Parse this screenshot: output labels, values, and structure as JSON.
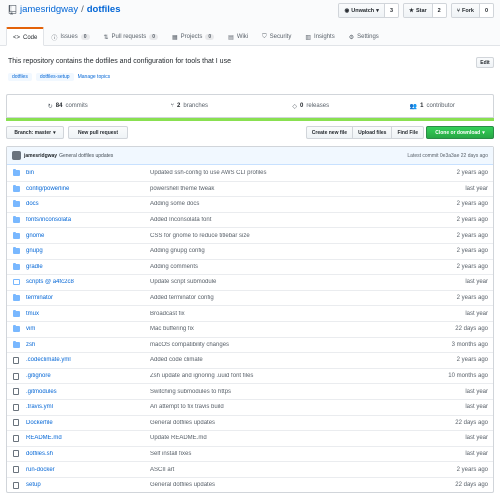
{
  "repo": {
    "owner": "jamesridgway",
    "separator": "/",
    "name": "dotfiles"
  },
  "actions": [
    {
      "label": "Unwatch",
      "count": "3",
      "icon": "eye-icon"
    },
    {
      "label": "Star",
      "count": "2",
      "icon": "star-icon"
    },
    {
      "label": "Fork",
      "count": "0",
      "icon": "fork-icon"
    }
  ],
  "tabs": [
    {
      "label": "Code",
      "icon": "code-icon",
      "active": true
    },
    {
      "label": "Issues",
      "count": "0",
      "icon": "issue-icon"
    },
    {
      "label": "Pull requests",
      "count": "0",
      "icon": "pull-request-icon"
    },
    {
      "label": "Projects",
      "count": "0",
      "icon": "project-icon"
    },
    {
      "label": "Wiki",
      "icon": "wiki-icon"
    },
    {
      "label": "Security",
      "icon": "shield-icon"
    },
    {
      "label": "Insights",
      "icon": "graph-icon"
    },
    {
      "label": "Settings",
      "icon": "gear-icon"
    }
  ],
  "description": "This repository contains the dotfiles and configuration for tools that I use",
  "edit_label": "Edit",
  "topics": [
    "dotfiles",
    "dotfiles-setup"
  ],
  "manage_topics": "Manage topics",
  "summary": [
    {
      "num": "84",
      "label": "commits",
      "icon": "history-icon"
    },
    {
      "num": "2",
      "label": "branches",
      "icon": "branch-icon"
    },
    {
      "num": "0",
      "label": "releases",
      "icon": "tag-icon"
    },
    {
      "num": "1",
      "label": "contributor",
      "icon": "people-icon"
    }
  ],
  "language_color": "#89e051",
  "branch_label": "Branch: master",
  "new_pr": "New pull request",
  "file_buttons": [
    "Create new file",
    "Upload files",
    "Find File"
  ],
  "clone_label": "Clone or download",
  "commit": {
    "author": "jamesridgway",
    "message": "General dotfiles updates",
    "latest": "Latest commit 0e3a3ae 22 days ago"
  },
  "files": [
    {
      "type": "dir",
      "name": "bin",
      "message": "Updated ssh-config to use AWS CLI profiles",
      "age": "2 years ago"
    },
    {
      "type": "dir",
      "name": "config/powerline",
      "message": "powershell theme tweak",
      "age": "last year"
    },
    {
      "type": "dir",
      "name": "docs",
      "message": "Adding some docs",
      "age": "2 years ago"
    },
    {
      "type": "dir",
      "name": "fonts/inconsolata",
      "message": "Added Inconsolata font",
      "age": "2 years ago"
    },
    {
      "type": "dir",
      "name": "gnome",
      "message": "CSS for gnome to reduce titlebar size",
      "age": "2 years ago"
    },
    {
      "type": "dir",
      "name": "gnupg",
      "message": "Adding gnupg config",
      "age": "2 years ago"
    },
    {
      "type": "dir",
      "name": "gradle",
      "message": "Adding comments",
      "age": "2 years ago"
    },
    {
      "type": "submodule",
      "name": "scripts @ a4fc2c8",
      "message": "Update script submodule",
      "age": "last year"
    },
    {
      "type": "dir",
      "name": "terminator",
      "message": "Added terminator config",
      "age": "2 years ago"
    },
    {
      "type": "dir",
      "name": "tmux",
      "message": "Broadcast fix",
      "age": "last year"
    },
    {
      "type": "dir",
      "name": "vim",
      "message": "Mac buffering fix",
      "age": "22 days ago"
    },
    {
      "type": "dir",
      "name": "zsh",
      "message": "macOS compatibility changes",
      "age": "3 months ago"
    },
    {
      "type": "file",
      "name": ".codeclimate.yml",
      "message": "Added code climate",
      "age": "2 years ago"
    },
    {
      "type": "file",
      "name": ".gitignore",
      "message": "Zsh update and ignoring .uuid font files",
      "age": "10 months ago"
    },
    {
      "type": "file",
      "name": ".gitmodules",
      "message": "Switching submodules to https",
      "age": "last year"
    },
    {
      "type": "file",
      "name": ".travis.yml",
      "message": "An attempt to fix travis build",
      "age": "last year"
    },
    {
      "type": "file",
      "name": "Dockerfile",
      "message": "General dotfiles updates",
      "age": "22 days ago"
    },
    {
      "type": "file",
      "name": "README.md",
      "message": "Update README.md",
      "age": "last year"
    },
    {
      "type": "file",
      "name": "dotfiles.sh",
      "message": "Self install fixes",
      "age": "last year"
    },
    {
      "type": "file",
      "name": "run-docker",
      "message": "ASCII art",
      "age": "2 years ago"
    },
    {
      "type": "file",
      "name": "setup",
      "message": "General dotfiles updates",
      "age": "22 days ago"
    }
  ]
}
